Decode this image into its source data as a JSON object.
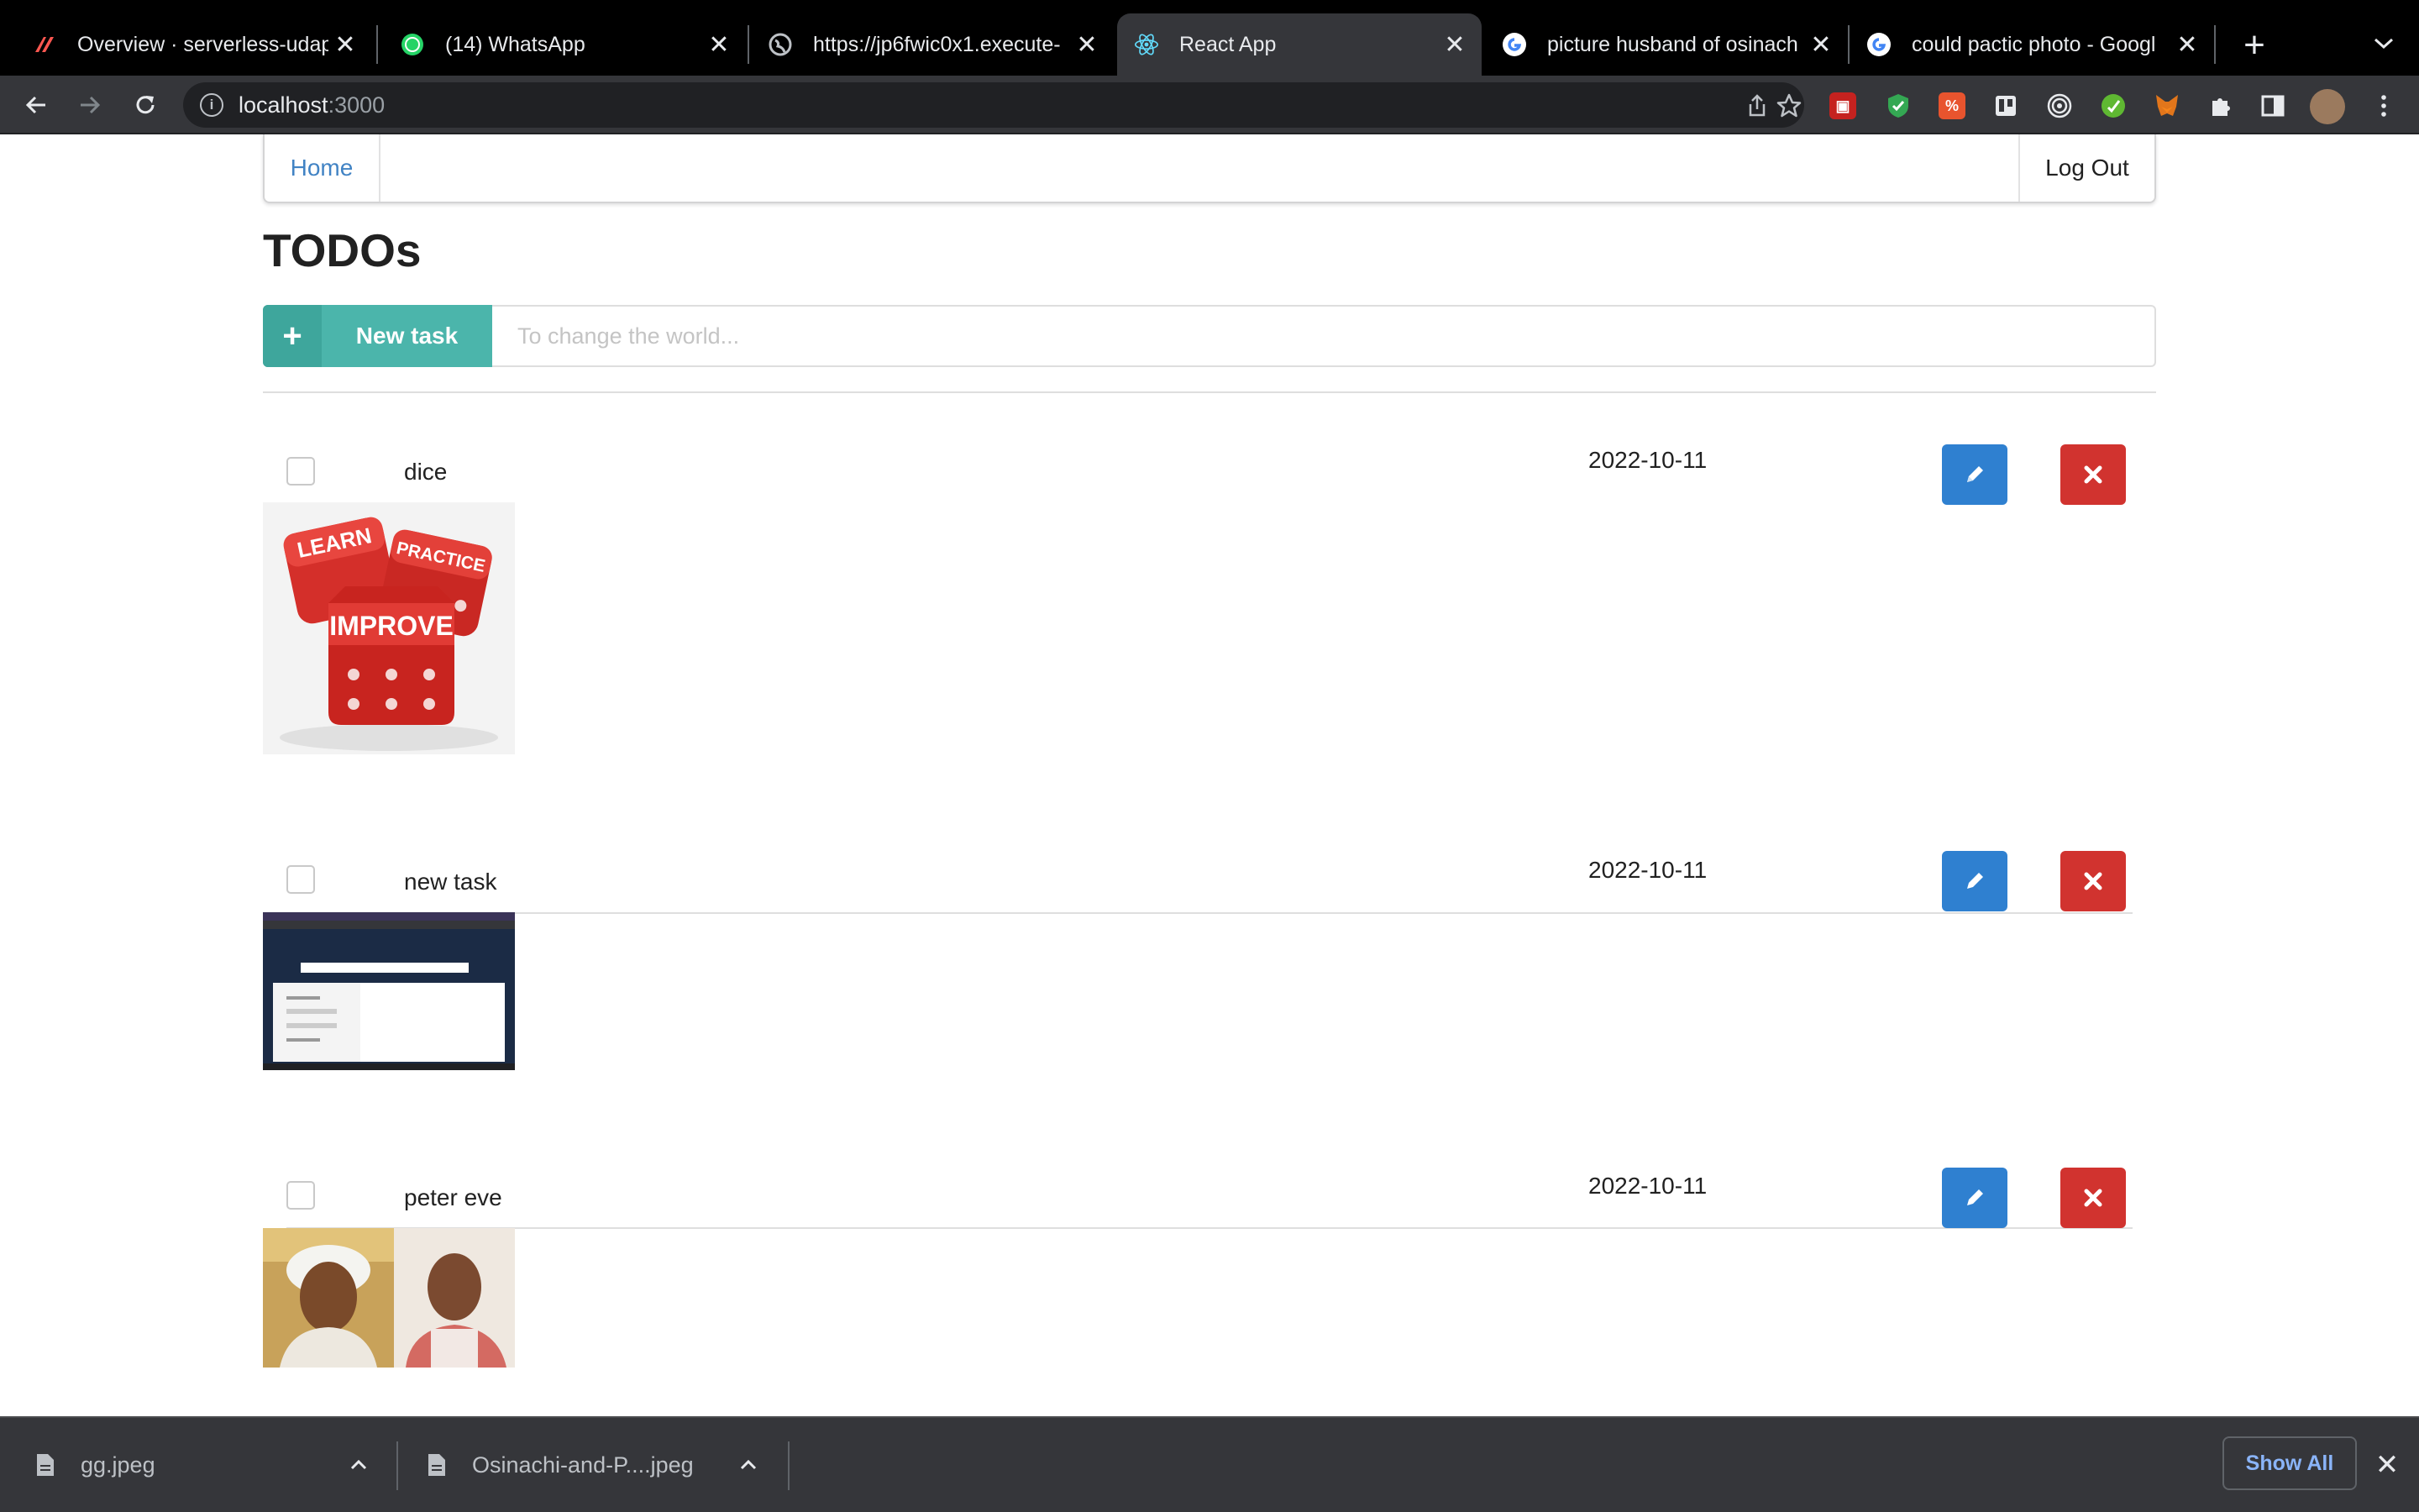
{
  "browser": {
    "tabs": [
      {
        "title": "Overview · serverless-udap",
        "icon": "serverless-logo-icon",
        "active": false
      },
      {
        "title": "(14) WhatsApp",
        "icon": "whatsapp-icon",
        "active": false
      },
      {
        "title": "https://jp6fwic0x1.execute-",
        "icon": "globe-icon",
        "active": false
      },
      {
        "title": "React App",
        "icon": "react-logo-icon",
        "active": true
      },
      {
        "title": "picture husband of osinach",
        "icon": "google-logo-icon",
        "active": false
      },
      {
        "title": "could pactic photo - Googl",
        "icon": "google-logo-icon",
        "active": false
      }
    ],
    "close_glyph": "✕",
    "new_tab_glyph": "+",
    "address": {
      "host": "localhost",
      "port": ":3000"
    }
  },
  "nav": {
    "home": "Home",
    "logout": "Log Out"
  },
  "page": {
    "title": "TODOs",
    "new_task_label": "New task",
    "new_task_plus": "+",
    "input_placeholder": "To change the world..."
  },
  "todos": [
    {
      "name": "dice",
      "due": "2022-10-11",
      "done": false,
      "image": "dice with words LEARN, PRACTICE, IMPROVE",
      "dice_words": [
        "LEARN",
        "PRACTICE",
        "IMPROVE"
      ]
    },
    {
      "name": "new task",
      "due": "2022-10-11",
      "done": false,
      "image": "screenshot of a web app"
    },
    {
      "name": "peter eve",
      "due": "2022-10-11",
      "done": false,
      "image": "portraits of a woman and a man"
    }
  ],
  "downloads": {
    "items": [
      {
        "name": "gg.jpeg"
      },
      {
        "name": "Osinachi-and-P....jpeg"
      }
    ],
    "show_all": "Show All",
    "close_glyph": "✕"
  },
  "colors": {
    "primary_button": "#2f80d0",
    "danger_button": "#d1332f",
    "teal_button": "#4bb5ab",
    "link": "#4183c4"
  }
}
